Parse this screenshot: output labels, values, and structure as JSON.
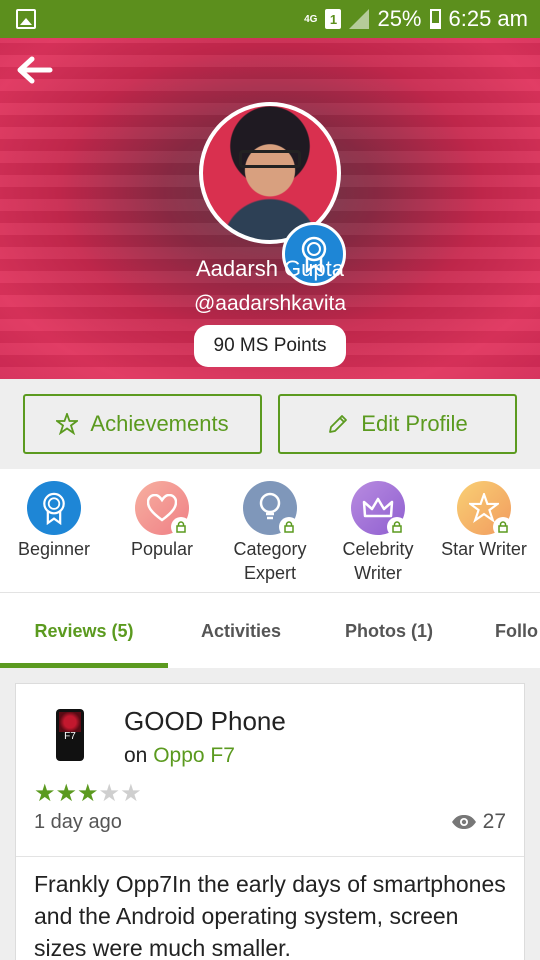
{
  "status_bar": {
    "network": "4G",
    "sim": "1",
    "battery": "25%",
    "time": "6:25 am"
  },
  "profile": {
    "name": "Aadarsh Gupta",
    "handle": "@aadarshkavita",
    "points": "90 MS Points"
  },
  "actions": {
    "achievements": "Achievements",
    "edit_profile": "Edit Profile"
  },
  "badges": [
    {
      "label": "Beginner",
      "icon": "ribbon-icon",
      "locked": false
    },
    {
      "label": "Popular",
      "icon": "heart-icon",
      "locked": true
    },
    {
      "label": "Category Expert",
      "icon": "lightbulb-icon",
      "locked": true
    },
    {
      "label": "Celebrity Writer",
      "icon": "crown-icon",
      "locked": true
    },
    {
      "label": "Star Writer",
      "icon": "star-icon",
      "locked": true
    }
  ],
  "tabs": [
    {
      "label": "Reviews (5)",
      "active": true
    },
    {
      "label": "Activities",
      "active": false
    },
    {
      "label": "Photos (1)",
      "active": false
    },
    {
      "label": "Follo",
      "active": false
    }
  ],
  "review": {
    "title": "GOOD Phone",
    "on_label": "on",
    "product": "Oppo F7",
    "thumb_label": "F7",
    "rating": 3,
    "rating_max": 5,
    "time": "1 day ago",
    "views": "27",
    "body": "Frankly Opp7In the early days of smartphones and the Android operating system, screen sizes were much smaller."
  },
  "colors": {
    "accent": "#5b9a1f",
    "status_bar": "#5c8f1d",
    "badge_blue": "#1e86d6"
  }
}
